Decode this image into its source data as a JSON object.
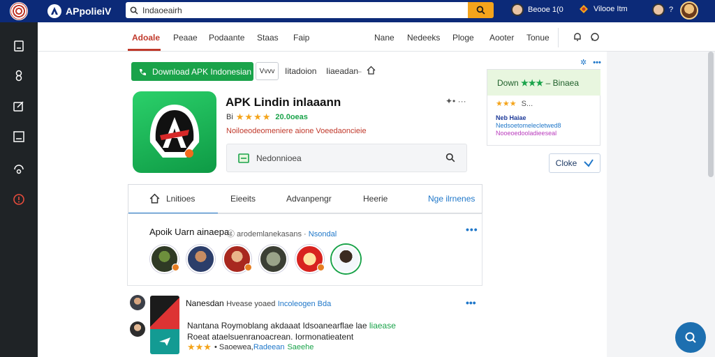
{
  "topbar": {
    "logo_text": "APpolieiV",
    "search_value": "Indaoeairh",
    "user1": "Beooe 1(0",
    "user2": "Vilooe Itm"
  },
  "nav": {
    "items": [
      "Adoale",
      "Peaae",
      "Podaante",
      "Staas",
      "Faip",
      "Nane",
      "Nedeeks",
      "Ploge",
      "Aooter",
      "Tonue"
    ]
  },
  "toolbar": {
    "download_label": "Download APK Indonesian",
    "mini_label": "Vvvv",
    "crumb1": "Iitadoion",
    "crumb2": "Iiaeadan"
  },
  "app": {
    "title": "APK Lindin inlaaann",
    "rating_prefix": "Bi",
    "stars": "★★★★",
    "rating_count": "20.0oeas",
    "red_line": "Noiloeodeomeniere aione Voeedaoncieie",
    "actions": "✦•   ···"
  },
  "inner_search": {
    "placeholder": "Nedonnioea"
  },
  "tabs": [
    "Lnitioes",
    "Eieeits",
    "Advanpengr",
    "Heerie",
    "Nge ilrnenes"
  ],
  "card": {
    "title": "Apoik Uarn ainaepa",
    "sub": "ⓖ arodemlanekasans ·",
    "link": "Nsondal",
    "dots": "•••"
  },
  "post": {
    "author": "Nanesdan",
    "meta": "Hvease yoaed",
    "tag": "Incoleogen Bda",
    "dots": "•••",
    "line1": "Nantana Roymoblang akdaaat Idsoanearflae lae",
    "line1_green": "liaease",
    "line2": "Roeat ataelsuenranoacrean. Iormonatieatent",
    "stars": "★★★",
    "rating_text": "• Saoewea, ",
    "rating_blue": "Radeean",
    "rating_green": "Saeehe"
  },
  "side": {
    "green_text": "Down",
    "green_bold": "★★★",
    "green_rest": "– Binaea",
    "stars": "★★★",
    "stars_text": "S...",
    "line1": "Neb Haiae",
    "line2": "Nedsoetomelecletwed8",
    "line3": "Nooeoedooladieeseal"
  },
  "close_label": "Cloke",
  "colors": {
    "topbar": "#0c2a78",
    "accent_green": "#1aa34a",
    "accent_red": "#c0392b",
    "accent_blue": "#1f77c9"
  }
}
